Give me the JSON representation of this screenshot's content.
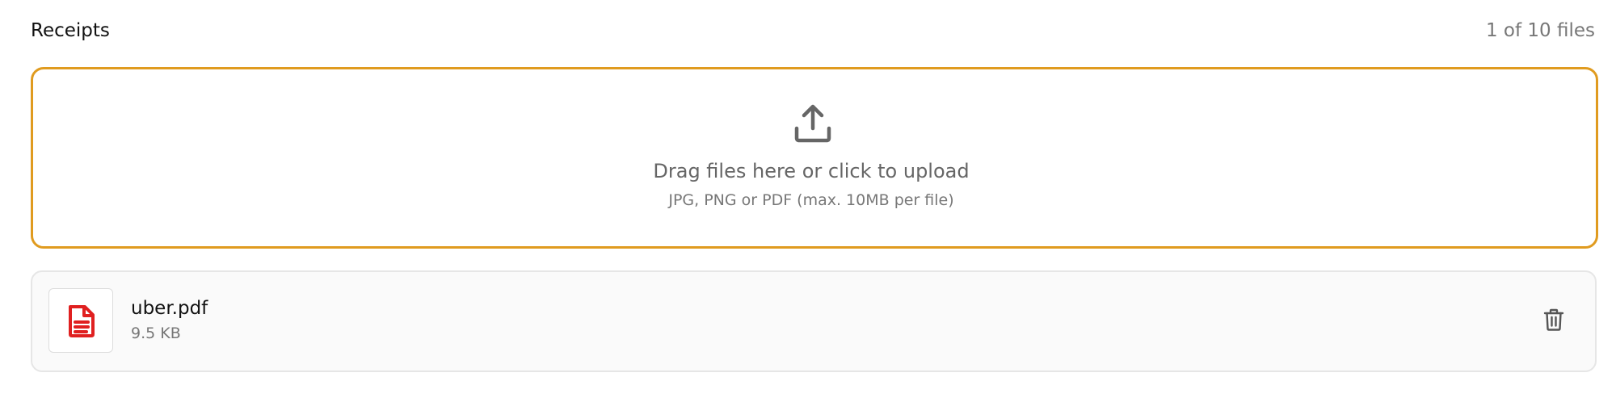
{
  "header": {
    "title": "Receipts",
    "file_count": "1 of 10 files"
  },
  "dropzone": {
    "title": "Drag files here or click to upload",
    "subtitle": "JPG, PNG or PDF (max. 10MB per file)",
    "icon": "upload-icon",
    "border_color": "#e09b1f"
  },
  "files": [
    {
      "name": "uber.pdf",
      "size": "9.5 KB",
      "icon": "pdf-file-icon",
      "icon_color": "#e02020",
      "action_icon": "trash-icon"
    }
  ]
}
